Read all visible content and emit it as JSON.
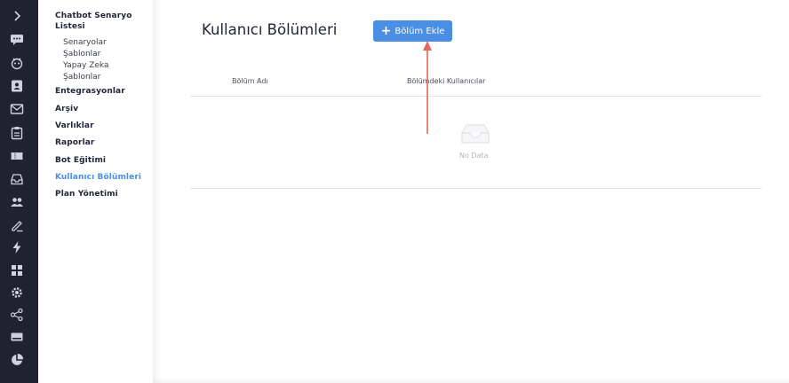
{
  "rail": {
    "icons": [
      "chevron-right-icon",
      "chat-icon",
      "bot-face-icon",
      "contact-book-icon",
      "mail-icon",
      "clipboard-icon",
      "ticket-icon",
      "inbox-icon",
      "users-icon",
      "edit-icon",
      "lightning-icon",
      "grid-icon",
      "settings-icon",
      "share-icon",
      "card-icon",
      "pie-chart-icon"
    ],
    "color": "#1f2230"
  },
  "sidebar": {
    "scenario_list_line1": "Chatbot Senaryo",
    "scenario_list_line2": "Listesi",
    "sub_items": [
      "Senaryolar",
      "Şablonlar",
      "Yapay Zeka",
      "Şablonlar"
    ],
    "items": [
      "Entegrasyonlar",
      "Arşiv",
      "Varlıklar",
      "Raporlar",
      "Bot Eğitimi",
      "Kullanıcı Bölümleri",
      "Plan Yönetimi"
    ],
    "active_item": "Kullanıcı Bölümleri"
  },
  "main": {
    "title": "Kullanıcı Bölümleri",
    "add_button_label": "Bölüm Ekle",
    "columns": [
      "Bölüm Adı",
      "Bölümdeki Kullanıcılar"
    ],
    "empty_text": "No Data"
  },
  "colors": {
    "accent": "#4a8fe3",
    "annotation_arrow": "#e2675c",
    "rail_bg": "#1f2230"
  }
}
